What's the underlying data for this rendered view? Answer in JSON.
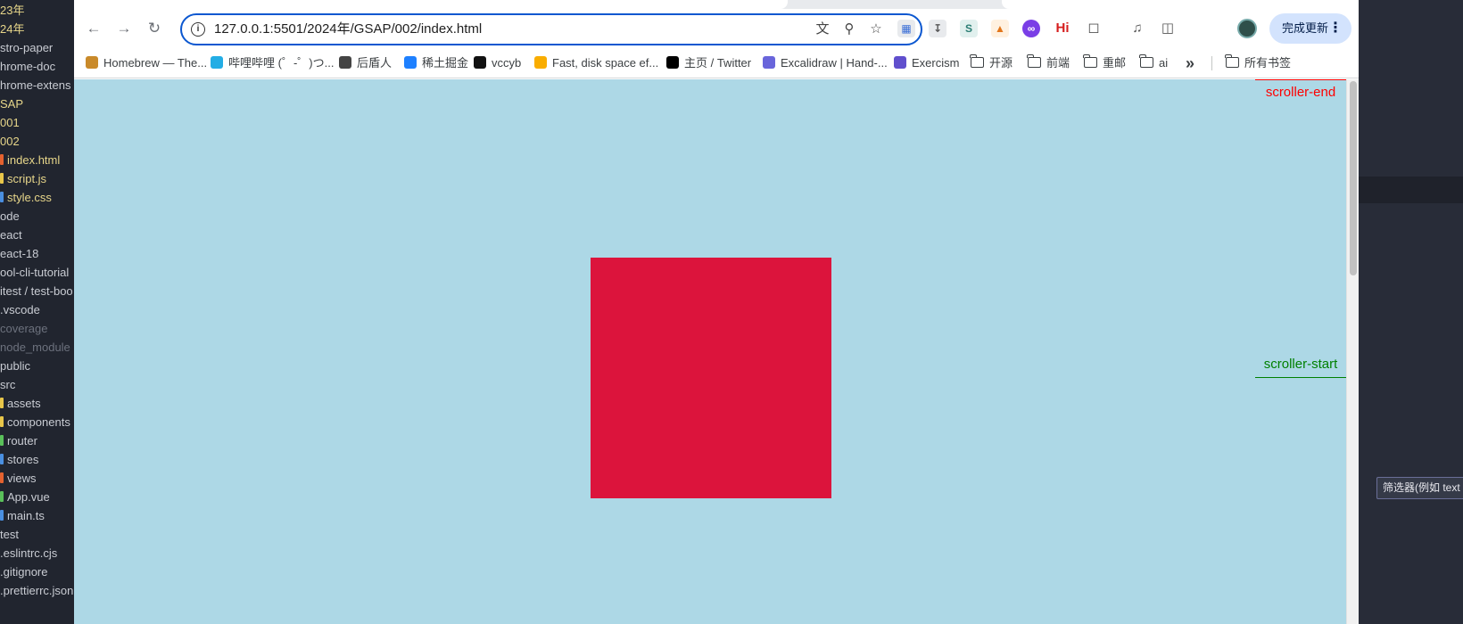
{
  "explorer": {
    "items": [
      {
        "label": "23年",
        "style": "yellow",
        "marker": ""
      },
      {
        "label": "24年",
        "style": "yellow",
        "marker": ""
      },
      {
        "label": "stro-paper",
        "style": "light",
        "marker": ""
      },
      {
        "label": "hrome-doc",
        "style": "light",
        "marker": ""
      },
      {
        "label": "hrome-extens",
        "style": "light",
        "marker": ""
      },
      {
        "label": "SAP",
        "style": "yellow",
        "marker": ""
      },
      {
        "label": "001",
        "style": "yellow",
        "marker": ""
      },
      {
        "label": "002",
        "style": "yellow",
        "marker": ""
      },
      {
        "label": "index.html",
        "style": "yellow",
        "marker": "#e4622f"
      },
      {
        "label": "script.js",
        "style": "yellow",
        "marker": "#e8c64a"
      },
      {
        "label": "style.css",
        "style": "yellow",
        "marker": "#4a8fe0"
      },
      {
        "label": "ode",
        "style": "light",
        "marker": ""
      },
      {
        "label": "eact",
        "style": "light",
        "marker": ""
      },
      {
        "label": "eact-18",
        "style": "light",
        "marker": ""
      },
      {
        "label": "ool-cli-tutorial",
        "style": "light",
        "marker": ""
      },
      {
        "label": "itest / test-boo",
        "style": "light",
        "marker": ""
      },
      {
        "label": ".vscode",
        "style": "light",
        "marker": ""
      },
      {
        "label": "coverage",
        "style": "dim",
        "marker": ""
      },
      {
        "label": "node_module",
        "style": "dim",
        "marker": ""
      },
      {
        "label": "public",
        "style": "light",
        "marker": ""
      },
      {
        "label": "src",
        "style": "light",
        "marker": ""
      },
      {
        "label": "assets",
        "style": "light",
        "marker": "#e8c64a"
      },
      {
        "label": "components",
        "style": "light",
        "marker": "#e8c64a"
      },
      {
        "label": "router",
        "style": "light",
        "marker": "#5ac05a"
      },
      {
        "label": "stores",
        "style": "light",
        "marker": "#4a8fe0"
      },
      {
        "label": "views",
        "style": "light",
        "marker": "#e4622f"
      },
      {
        "label": "App.vue",
        "style": "light",
        "marker": "#5ac05a"
      },
      {
        "label": "main.ts",
        "style": "light",
        "marker": "#4a8fe0"
      },
      {
        "label": "test",
        "style": "light",
        "marker": ""
      },
      {
        "label": ".eslintrc.cjs",
        "style": "light",
        "marker": ""
      },
      {
        "label": ".gitignore",
        "style": "light",
        "marker": ""
      },
      {
        "label": ".prettierrc.json",
        "style": "light",
        "marker": ""
      }
    ]
  },
  "browser": {
    "url": "127.0.0.1:5501/2024年/GSAP/002/index.html",
    "update_button": "完成更新",
    "bookmarks": [
      {
        "label": "Homebrew — The...",
        "icon": "beer-icon",
        "color": "#c98a2a"
      },
      {
        "label": "哔哩哔哩 (゜-゜)つ...",
        "icon": "bilibili-icon",
        "color": "#23ade5"
      },
      {
        "label": "后盾人",
        "icon": "globe-icon",
        "color": "#444444"
      },
      {
        "label": "稀土掘金",
        "icon": "juejin-icon",
        "color": "#1e80ff"
      },
      {
        "label": "vccyb",
        "icon": "github-icon",
        "color": "#111111"
      },
      {
        "label": "Fast, disk space ef...",
        "icon": "pnpm-icon",
        "color": "#f9ad00"
      },
      {
        "label": "主页 / Twitter",
        "icon": "twitter-x-icon",
        "color": "#000000"
      },
      {
        "label": "Excalidraw | Hand-...",
        "icon": "excalidraw-icon",
        "color": "#6965db"
      },
      {
        "label": "Exercism",
        "icon": "exercism-icon",
        "color": "#604fcd"
      }
    ],
    "folders": [
      "开源",
      "前端",
      "重邮",
      "ai"
    ],
    "overflow": "»",
    "all_bookmarks": "所有书签"
  },
  "page": {
    "scroller_end": "scroller-end",
    "scroller_start": "scroller-start",
    "box_color": "#dc143c",
    "background_color": "#add8e6"
  },
  "right_panel": {
    "filter_placeholder": "筛选器(例如 text"
  }
}
